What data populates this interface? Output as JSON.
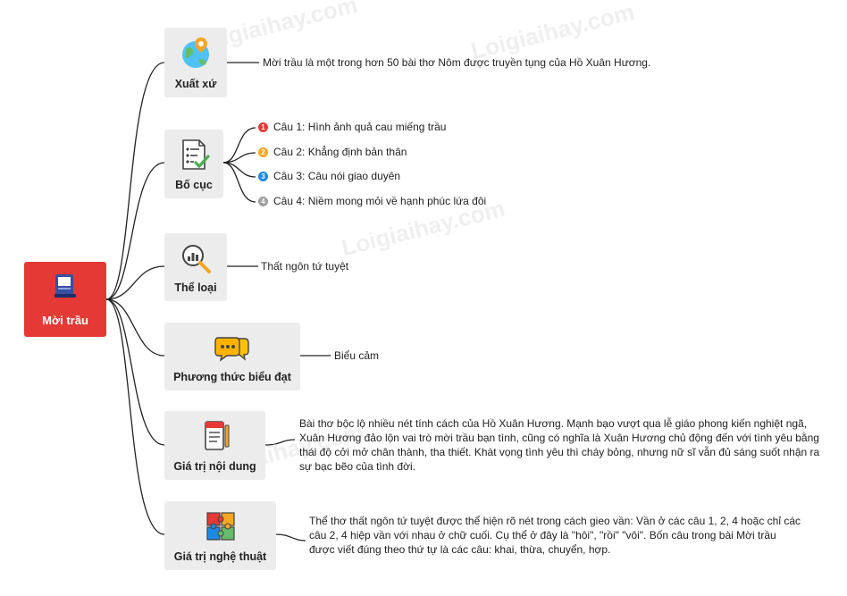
{
  "root": {
    "label": "Mời trầu",
    "color": "#e53935",
    "icon": "book-icon"
  },
  "branches": [
    {
      "label": "Xuất xứ",
      "icon": "globe-pin-icon",
      "text": "Mời trầu là một trong hơn 50 bài thơ Nôm được truyền tụng của Hồ Xuân Hương."
    },
    {
      "label": "Bố cục",
      "icon": "checklist-icon",
      "items": [
        {
          "num": "1",
          "color": "#e53935",
          "text": "Câu 1: Hình ảnh quả cau miếng trầu"
        },
        {
          "num": "2",
          "color": "#f5a623",
          "text": "Câu 2: Khẳng định bản thân"
        },
        {
          "num": "3",
          "color": "#1e88e5",
          "text": "Câu 3: Câu nói giao duyên"
        },
        {
          "num": "4",
          "color": "#9e9e9e",
          "text": "Câu 4: Niềm mong mỏi về hạnh phúc lứa đôi"
        }
      ]
    },
    {
      "label": "Thể loại",
      "icon": "magnifier-chart-icon",
      "text": "Thất ngôn tứ tuyệt"
    },
    {
      "label": "Phương thức biểu đạt",
      "icon": "chat-bubbles-icon",
      "text": "Biểu cảm"
    },
    {
      "label": "Giá trị nội dung",
      "icon": "notebook-icon",
      "text": "Bài thơ bộc lộ nhiều nét tính cách của Hồ Xuân Hương. Mạnh bạo vượt qua lễ giáo phong kiến nghiệt ngã, Xuân Hương đảo lộn vai trò mời trầu bạn tình, cũng có nghĩa là Xuân Hương chủ động đến với tình yêu bằng thái độ cởi mở chân thành, tha thiết. Khát vọng tình yêu thì cháy bỏng, nhưng nữ sĩ vẫn đủ sáng suốt nhận ra sự bạc bẽo của tình đời."
    },
    {
      "label": "Giá trị nghệ thuật",
      "icon": "puzzle-icon",
      "text": "Thể thơ thất ngôn tứ tuyệt được thể hiện rõ nét trong cách gieo vần: Vần ở các câu 1, 2, 4 hoặc chỉ các câu 2, 4 hiệp vần với nhau ở chữ cuối. Cụ thể ở đây là \"hôi\", \"rồi\" \"vôi\". Bốn câu trong bài Mời trầu được viết đúng theo thứ tự là các câu: khai, thừa, chuyển, hợp."
    }
  ],
  "watermark": "Loigiaihay.com"
}
